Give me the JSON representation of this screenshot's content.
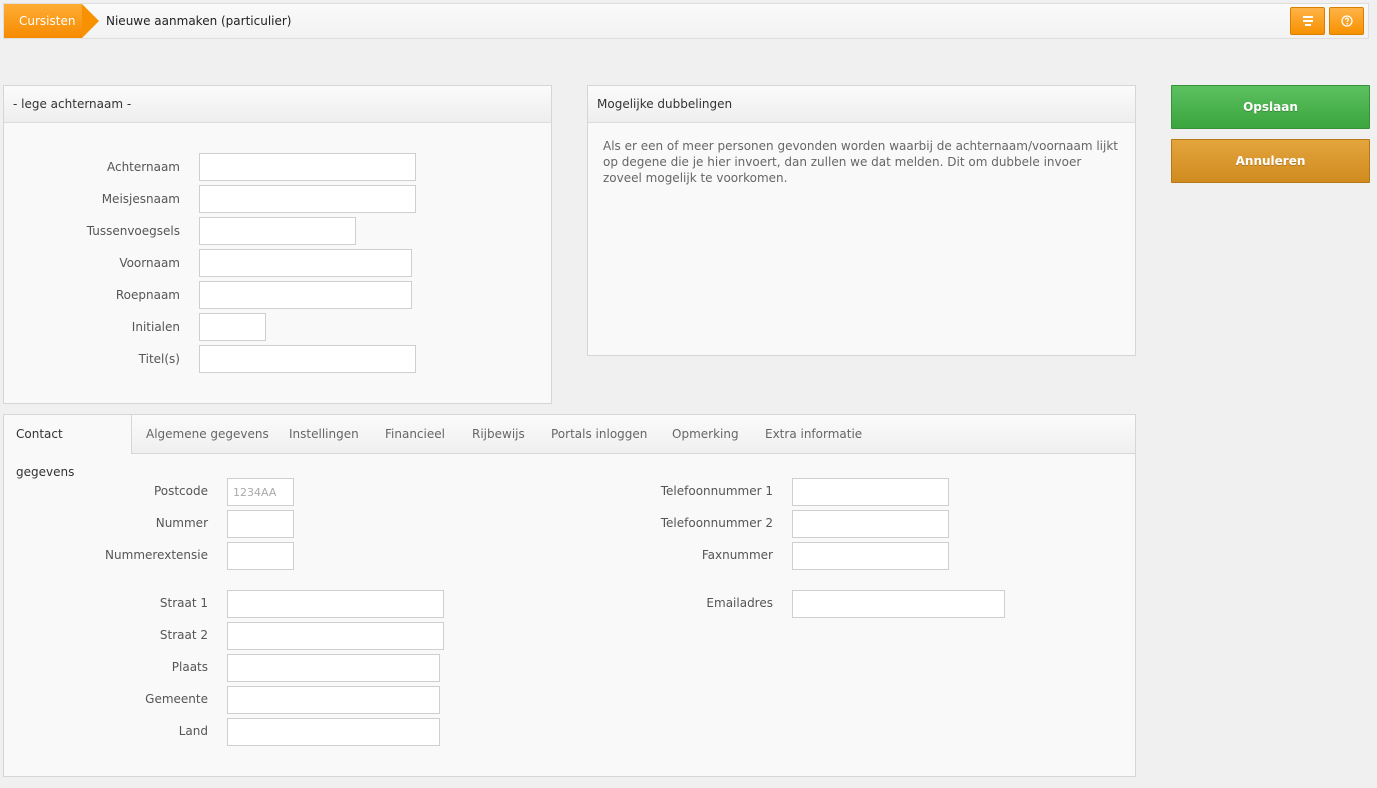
{
  "header": {
    "breadcrumb": "Cursisten",
    "title": "Nieuwe aanmaken (particulier)"
  },
  "name_panel": {
    "title": "- lege achternaam -",
    "fields": [
      {
        "label": "Achternaam",
        "value": ""
      },
      {
        "label": "Meisjesnaam",
        "value": ""
      },
      {
        "label": "Tussenvoegsels",
        "value": ""
      },
      {
        "label": "Voornaam",
        "value": ""
      },
      {
        "label": "Roepnaam",
        "value": ""
      },
      {
        "label": "Initialen",
        "value": ""
      },
      {
        "label": "Titel(s)",
        "value": ""
      }
    ]
  },
  "duplicates_panel": {
    "title": "Mogelijke dubbelingen",
    "text": "Als er een of meer personen gevonden worden waarbij de achternaam/voornaam lijkt op degene die je hier invoert, dan zullen we dat melden. Dit om dubbele invoer zoveel mogelijk te voorkomen."
  },
  "actions": {
    "save": "Opslaan",
    "cancel": "Annuleren"
  },
  "tabs": [
    {
      "label": "Contact gegevens",
      "active": true
    },
    {
      "label": "Algemene gegevens",
      "active": false
    },
    {
      "label": "Instellingen",
      "active": false
    },
    {
      "label": "Financieel",
      "active": false
    },
    {
      "label": "Rijbewijs",
      "active": false
    },
    {
      "label": "Portals inloggen",
      "active": false
    },
    {
      "label": "Opmerking",
      "active": false
    },
    {
      "label": "Extra informatie",
      "active": false
    }
  ],
  "contact": {
    "left": [
      {
        "label": "Postcode",
        "value": "",
        "placeholder": "1234AA"
      },
      {
        "label": "Nummer",
        "value": ""
      },
      {
        "label": "Nummerextensie",
        "value": ""
      },
      {
        "label": "Straat 1",
        "value": ""
      },
      {
        "label": "Straat 2",
        "value": ""
      },
      {
        "label": "Plaats",
        "value": ""
      },
      {
        "label": "Gemeente",
        "value": ""
      },
      {
        "label": "Land",
        "value": ""
      }
    ],
    "right": [
      {
        "label": "Telefoonnummer 1",
        "value": ""
      },
      {
        "label": "Telefoonnummer 2",
        "value": ""
      },
      {
        "label": "Faxnummer",
        "value": ""
      },
      {
        "label": "Emailadres",
        "value": ""
      }
    ]
  },
  "colors": {
    "accent": "#f79100",
    "save": "#45ab48",
    "cancel": "#d7952b"
  },
  "icons": [
    "menu-icon",
    "help-icon"
  ]
}
